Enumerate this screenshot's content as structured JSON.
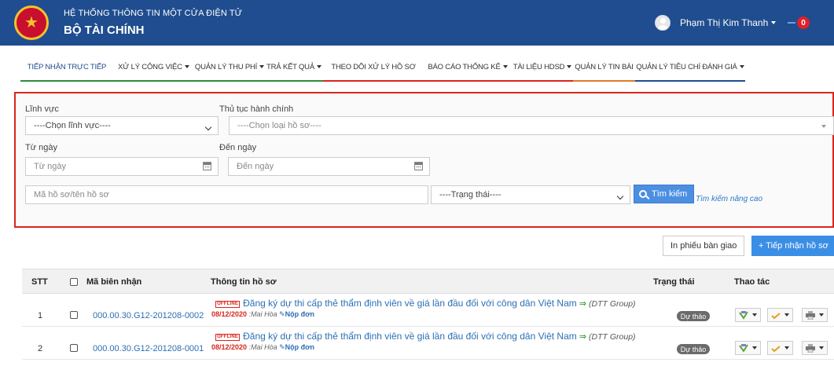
{
  "header": {
    "system_title": "HỆ THỐNG THÔNG TIN MỘT CỬA ĐIỆN TỬ",
    "org_title": "BỘ TÀI CHÍNH",
    "user_name": "Phạm Thị Kim Thanh",
    "notification_count": "0"
  },
  "nav": {
    "items": [
      {
        "label": "TIẾP NHẬN TRỰC TIẾP"
      },
      {
        "label": "XỬ LÝ CÔNG VIỆC"
      },
      {
        "label": "QUẢN LÝ THU PHÍ"
      },
      {
        "label": "TRẢ KẾT QUẢ"
      },
      {
        "label": "THEO DÕI XỬ LÝ HỒ SƠ"
      },
      {
        "label": "BÁO CÁO THỐNG KÊ"
      },
      {
        "label": "TÀI LIỆU HDSD"
      },
      {
        "label": "QUẢN LÝ TIN BÀI"
      },
      {
        "label": "QUẢN LÝ TIÊU CHÍ ĐÁNH GIÁ"
      }
    ],
    "colors": [
      "#2e8b3d",
      "#2e8b3d",
      "#2e8b3d",
      "#2e8b3d",
      "#d9251c",
      "#d9251c",
      "#d9251c",
      "#e07b27",
      "#1f4d8f"
    ]
  },
  "search": {
    "field_label": "Lĩnh vực",
    "field_value": "----Chọn lĩnh vực----",
    "procedure_label": "Thủ tục hành chính",
    "procedure_value": "----Chọn loại hồ sơ----",
    "from_label": "Từ ngày",
    "from_placeholder": "Từ ngày",
    "to_label": "Đến ngày",
    "to_placeholder": "Đến ngày",
    "code_placeholder": "Mã hồ sơ/tên hồ sơ",
    "status_value": "----Trạng thái----",
    "search_button": "Tìm kiếm",
    "advanced_link": "Tìm kiếm nâng cao"
  },
  "actions": {
    "print_handover": "In phiếu bàn giao",
    "add_record": "+ Tiếp nhận hồ sơ"
  },
  "table": {
    "headers": {
      "stt": "STT",
      "code": "Mã biên nhận",
      "info": "Thông tin hồ sơ",
      "status": "Trạng thái",
      "actions": "Thao tác"
    },
    "rows": [
      {
        "stt": "1",
        "code": "000.00.30.G12-201208-0002",
        "badge": "OFFLINE",
        "title": "Đăng ký dự thi cấp thẻ thẩm định viên về giá lần đầu đối với công dân Việt Nam",
        "group": "(DTT Group)",
        "date": "08/12/2020",
        "person": "Mai Hòa",
        "submit": "Nộp đơn",
        "status": "Dự thảo"
      },
      {
        "stt": "2",
        "code": "000.00.30.G12-201208-0001",
        "badge": "OFFLINE",
        "title": "Đăng ký dự thi cấp thẻ thẩm định viên về giá lần đầu đối với công dân Việt Nam",
        "group": "(DTT Group)",
        "date": "08/12/2020",
        "person": "Mai Hòa",
        "submit": "Nộp đơn",
        "status": "Dự thảo"
      }
    ]
  }
}
